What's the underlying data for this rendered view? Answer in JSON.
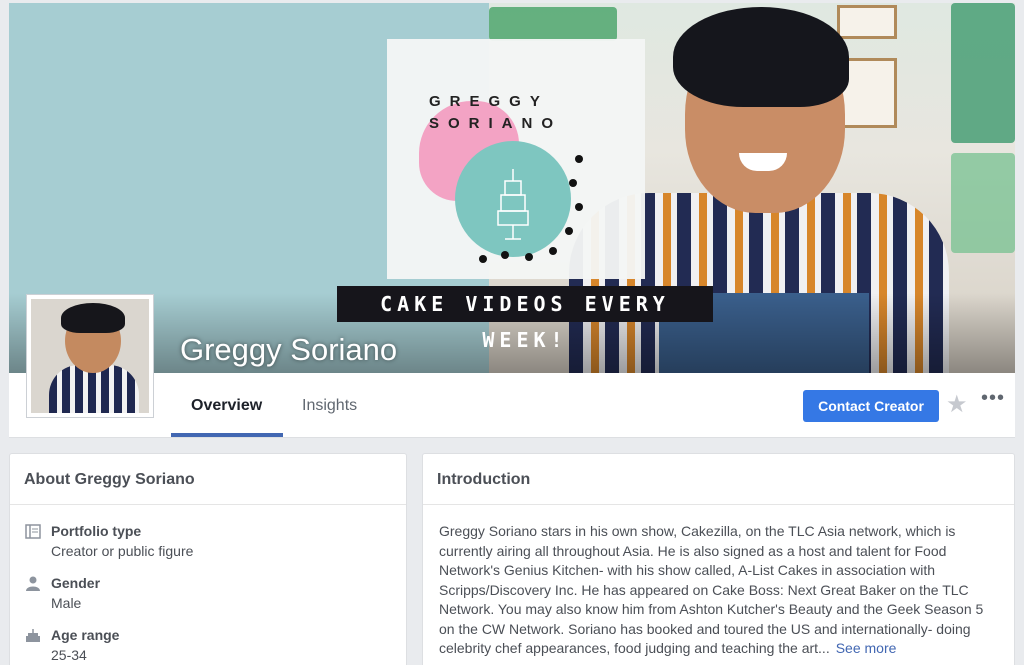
{
  "cover": {
    "brand_line1": "GREGGY",
    "brand_line2": "SORIANO",
    "banner_text": "CAKE VIDEOS EVERY WEEK!",
    "page_name": "Greggy Soriano"
  },
  "nav": {
    "tabs": [
      {
        "label": "Overview",
        "active": true
      },
      {
        "label": "Insights",
        "active": false
      }
    ],
    "contact_label": "Contact Creator",
    "accent_color": "#3578e5"
  },
  "about": {
    "title": "About Greggy Soriano",
    "rows": [
      {
        "icon": "portfolio-icon",
        "label": "Portfolio type",
        "value": "Creator or public figure"
      },
      {
        "icon": "person-icon",
        "label": "Gender",
        "value": "Male"
      },
      {
        "icon": "cake-icon",
        "label": "Age range",
        "value": "25-34"
      }
    ]
  },
  "intro": {
    "title": "Introduction",
    "text": "Greggy Soriano stars in his own show, Cakezilla, on the TLC Asia network, which is currently airing all throughout Asia. He is also signed as a host and talent for Food Network's Genius Kitchen- with his show called, A-List Cakes in association with Scripps/Discovery Inc. He has appeared on Cake Boss: Next Great Baker on the TLC Network. You may also know him from Ashton Kutcher's Beauty and the Geek Season 5 on the CW Network. Soriano has booked and toured the US and internationally- doing celebrity chef appearances, food judging and teaching the art...",
    "see_more": "See more"
  }
}
